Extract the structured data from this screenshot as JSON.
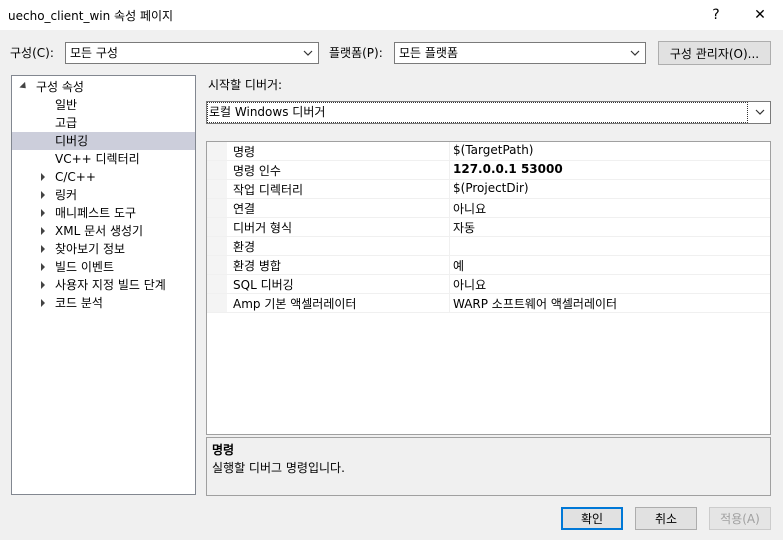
{
  "window": {
    "title": "uecho_client_win 속성 페이지",
    "help_glyph": "?",
    "close_glyph": "✕"
  },
  "config_row": {
    "config_label": "구성(C):",
    "config_value": "모든 구성",
    "platform_label": "플랫폼(P):",
    "platform_value": "모든 플랫폼",
    "manager_button": "구성 관리자(O)..."
  },
  "tree": {
    "items": [
      {
        "label": "구성 속성"
      },
      {
        "label": "일반"
      },
      {
        "label": "고급"
      },
      {
        "label": "디버깅"
      },
      {
        "label": "VC++ 디렉터리"
      },
      {
        "label": "C/C++"
      },
      {
        "label": "링커"
      },
      {
        "label": "매니페스트 도구"
      },
      {
        "label": "XML 문서 생성기"
      },
      {
        "label": "찾아보기 정보"
      },
      {
        "label": "빌드 이벤트"
      },
      {
        "label": "사용자 지정 빌드 단계"
      },
      {
        "label": "코드 분석"
      }
    ],
    "selected": "디버깅"
  },
  "debugger": {
    "label": "시작할 디버거:",
    "value": "로컬 Windows 디버거"
  },
  "properties": [
    {
      "name": "명령",
      "value": "$(TargetPath)"
    },
    {
      "name": "명령 인수",
      "value": "127.0.0.1 53000"
    },
    {
      "name": "작업 디렉터리",
      "value": "$(ProjectDir)"
    },
    {
      "name": "연결",
      "value": "아니요"
    },
    {
      "name": "디버거 형식",
      "value": "자동"
    },
    {
      "name": "환경",
      "value": ""
    },
    {
      "name": "환경 병합",
      "value": "예"
    },
    {
      "name": "SQL 디버깅",
      "value": "아니요"
    },
    {
      "name": "Amp 기본 액셀러레이터",
      "value": "WARP 소프트웨어 액셀러레이터"
    }
  ],
  "description": {
    "title": "명령",
    "text": "실행할 디버그 명령입니다."
  },
  "buttons": {
    "ok": "확인",
    "cancel": "취소",
    "apply": "적용(A)"
  },
  "colors": {
    "selection": "#cccedb",
    "accent": "#0078d7"
  }
}
